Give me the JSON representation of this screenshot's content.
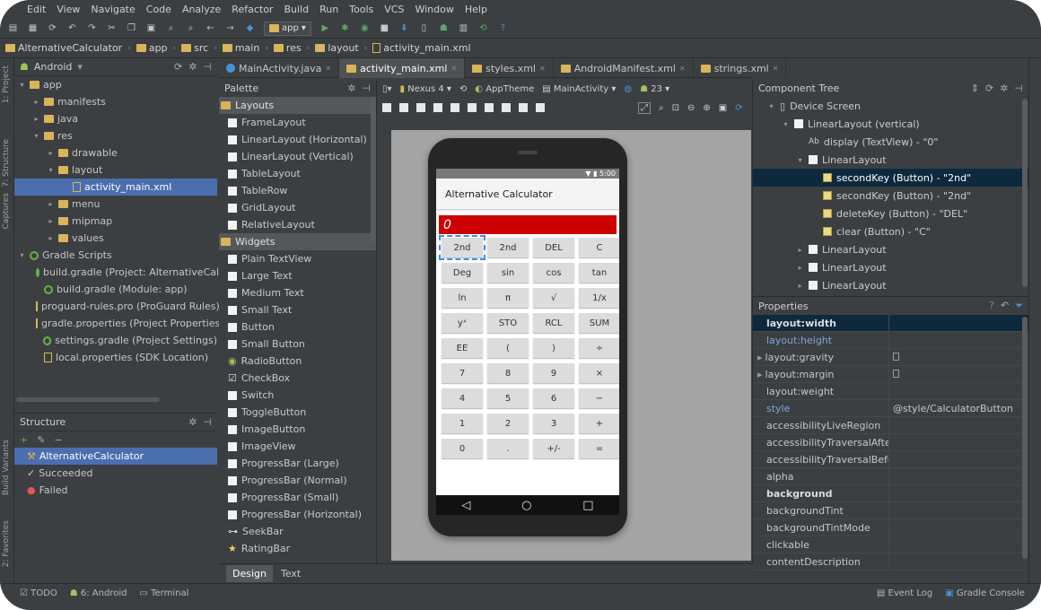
{
  "menu": [
    "Edit",
    "View",
    "Navigate",
    "Code",
    "Analyze",
    "Refactor",
    "Build",
    "Run",
    "Tools",
    "VCS",
    "Window",
    "Help"
  ],
  "toolbar": {
    "config_label": "app"
  },
  "breadcrumb": [
    "AlternativeCalculator",
    "app",
    "src",
    "main",
    "res",
    "layout",
    "activity_main.xml"
  ],
  "project": {
    "title": "Android",
    "tree": [
      {
        "label": "app",
        "level": 0,
        "open": true
      },
      {
        "label": "manifests",
        "level": 1,
        "open": false
      },
      {
        "label": "java",
        "level": 1,
        "open": false
      },
      {
        "label": "res",
        "level": 1,
        "open": true
      },
      {
        "label": "drawable",
        "level": 2,
        "open": false
      },
      {
        "label": "layout",
        "level": 2,
        "open": true
      },
      {
        "label": "activity_main.xml",
        "level": 3,
        "selected": true
      },
      {
        "label": "menu",
        "level": 2,
        "open": false
      },
      {
        "label": "mipmap",
        "level": 2,
        "open": false
      },
      {
        "label": "values",
        "level": 2,
        "open": false
      },
      {
        "label": "Gradle Scripts",
        "level": 0,
        "open": true,
        "gradle": true
      },
      {
        "label": "build.gradle (Project: AlternativeCalc)",
        "level": 1,
        "gradle": true
      },
      {
        "label": "build.gradle (Module: app)",
        "level": 1,
        "gradle": true
      },
      {
        "label": "proguard-rules.pro (ProGuard Rules)",
        "level": 1
      },
      {
        "label": "gradle.properties (Project Properties)",
        "level": 1
      },
      {
        "label": "settings.gradle (Project Settings)",
        "level": 1,
        "gradle": true
      },
      {
        "label": "local.properties (SDK Location)",
        "level": 1
      }
    ]
  },
  "structure": {
    "title": "Structure",
    "items": [
      {
        "label": "AlternativeCalculator",
        "selected": true
      },
      {
        "label": "Succeeded"
      },
      {
        "label": "Failed"
      }
    ]
  },
  "tabs": [
    {
      "label": "MainActivity.java",
      "kind": "class"
    },
    {
      "label": "activity_main.xml",
      "kind": "xml",
      "active": true
    },
    {
      "label": "styles.xml",
      "kind": "xml"
    },
    {
      "label": "AndroidManifest.xml",
      "kind": "xml"
    },
    {
      "label": "strings.xml",
      "kind": "xml"
    }
  ],
  "palette": {
    "title": "Palette",
    "groups": [
      {
        "name": "Layouts",
        "items": [
          "FrameLayout",
          "LinearLayout (Horizontal)",
          "LinearLayout (Vertical)",
          "TableLayout",
          "TableRow",
          "GridLayout",
          "RelativeLayout"
        ]
      },
      {
        "name": "Widgets",
        "items": [
          "Plain TextView",
          "Large Text",
          "Medium Text",
          "Small Text",
          "Button",
          "Small Button",
          "RadioButton",
          "CheckBox",
          "Switch",
          "ToggleButton",
          "ImageButton",
          "ImageView",
          "ProgressBar (Large)",
          "ProgressBar (Normal)",
          "ProgressBar (Small)",
          "ProgressBar (Horizontal)",
          "SeekBar",
          "RatingBar"
        ]
      }
    ]
  },
  "designer": {
    "device_label": "Nexus 4",
    "theme_label": "AppTheme",
    "activity_label": "MainActivity",
    "api_label": "23"
  },
  "phone": {
    "status_time": "5:00",
    "app_title": "Alternative Calculator",
    "display": "0",
    "keys": [
      "2nd",
      "2nd",
      "DEL",
      "C",
      "Deg",
      "sin",
      "cos",
      "tan",
      "ln",
      "π",
      "√",
      "1/x",
      "yˣ",
      "STO",
      "RCL",
      "SUM",
      "EE",
      "(",
      ")",
      "÷",
      "7",
      "8",
      "9",
      "×",
      "4",
      "5",
      "6",
      "−",
      "1",
      "2",
      "3",
      "+",
      "0",
      ".",
      "+/-",
      "="
    ]
  },
  "component_tree": {
    "title": "Component Tree",
    "rows": [
      {
        "label": "Device Screen",
        "depth": 0
      },
      {
        "label": "LinearLayout (vertical)",
        "depth": 1
      },
      {
        "label": "display (TextView) - \"0\"",
        "depth": 2
      },
      {
        "label": "LinearLayout",
        "depth": 2
      },
      {
        "label": "secondKey (Button) - \"2nd\"",
        "depth": 3,
        "selected": true
      },
      {
        "label": "secondKey (Button) - \"2nd\"",
        "depth": 3
      },
      {
        "label": "deleteKey (Button) - \"DEL\"",
        "depth": 3
      },
      {
        "label": "clear (Button) - \"C\"",
        "depth": 3
      },
      {
        "label": "LinearLayout",
        "depth": 2
      },
      {
        "label": "LinearLayout",
        "depth": 2
      },
      {
        "label": "LinearLayout",
        "depth": 2
      }
    ]
  },
  "properties": {
    "title": "Properties",
    "rows": [
      {
        "key": "layout:width",
        "value": "",
        "style": "bold",
        "selected": true
      },
      {
        "key": "layout:height",
        "value": "",
        "style": "blue"
      },
      {
        "key": "layout:gravity",
        "value": "",
        "checkbox": true,
        "expand": true
      },
      {
        "key": "layout:margin",
        "value": "",
        "checkbox": true,
        "expand": true
      },
      {
        "key": "layout:weight",
        "value": ""
      },
      {
        "key": "style",
        "value": "@style/CalculatorButton",
        "style": "blue"
      },
      {
        "key": "accessibilityLiveRegion",
        "value": ""
      },
      {
        "key": "accessibilityTraversalAfter",
        "value": ""
      },
      {
        "key": "accessibilityTraversalBefore",
        "value": ""
      },
      {
        "key": "alpha",
        "value": ""
      },
      {
        "key": "background",
        "value": "",
        "style": "bold"
      },
      {
        "key": "backgroundTint",
        "value": ""
      },
      {
        "key": "backgroundTintMode",
        "value": ""
      },
      {
        "key": "clickable",
        "value": ""
      },
      {
        "key": "contentDescription",
        "value": ""
      }
    ]
  },
  "editor_tabs": {
    "design": "Design",
    "text": "Text"
  },
  "status": {
    "left": [
      "TODO",
      "6: Android",
      "Terminal"
    ],
    "right": [
      "Event Log",
      "Gradle Console"
    ]
  }
}
